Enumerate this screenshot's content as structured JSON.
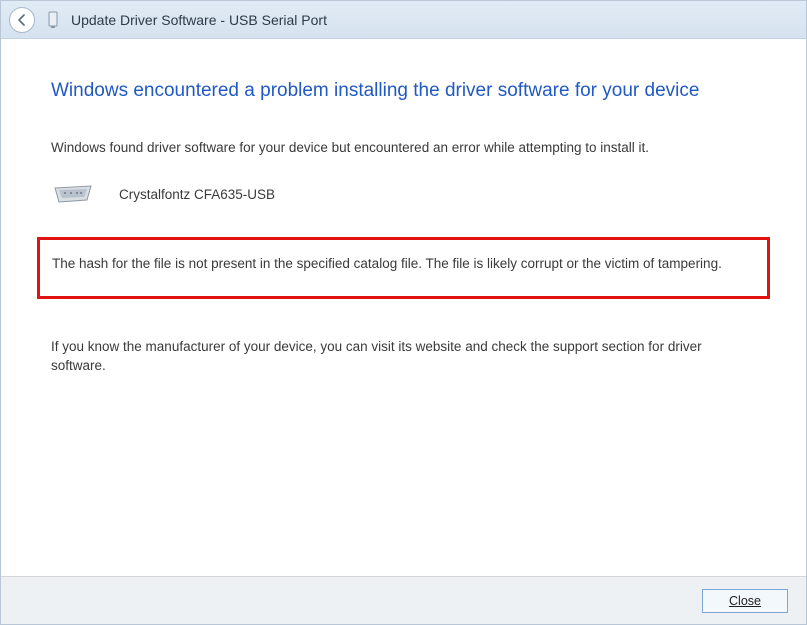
{
  "window": {
    "title": "Update Driver Software - USB Serial Port"
  },
  "content": {
    "heading": "Windows encountered a problem installing the driver software for your device",
    "intro": "Windows found driver software for your device but encountered an error while attempting to install it.",
    "device_name": "Crystalfontz CFA635-USB",
    "error_message": "The hash for the file is not present in the specified catalog file. The file is likely corrupt or the victim of tampering.",
    "help_text": "If you know the manufacturer of your device, you can visit its website and check the support section for driver software."
  },
  "footer": {
    "close_label": "Close"
  }
}
